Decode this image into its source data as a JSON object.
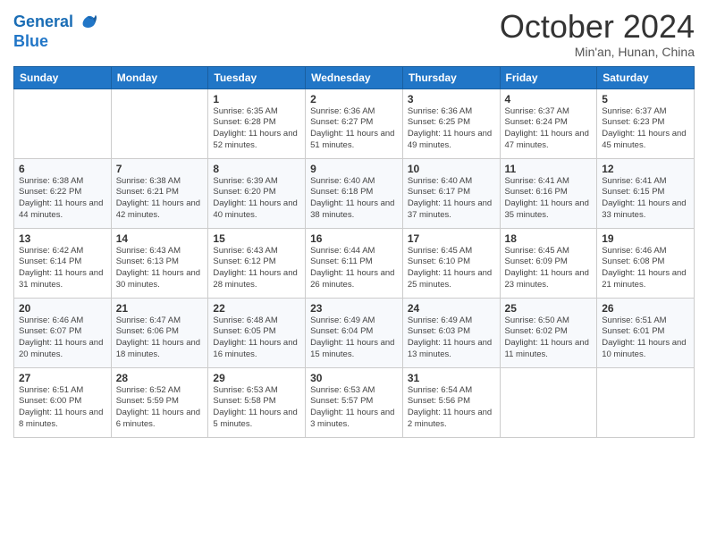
{
  "header": {
    "logo_line1": "General",
    "logo_line2": "Blue",
    "month": "October 2024",
    "location": "Min'an, Hunan, China"
  },
  "weekdays": [
    "Sunday",
    "Monday",
    "Tuesday",
    "Wednesday",
    "Thursday",
    "Friday",
    "Saturday"
  ],
  "weeks": [
    [
      {
        "day": "",
        "sunrise": "",
        "sunset": "",
        "daylight": ""
      },
      {
        "day": "",
        "sunrise": "",
        "sunset": "",
        "daylight": ""
      },
      {
        "day": "1",
        "sunrise": "Sunrise: 6:35 AM",
        "sunset": "Sunset: 6:28 PM",
        "daylight": "Daylight: 11 hours and 52 minutes."
      },
      {
        "day": "2",
        "sunrise": "Sunrise: 6:36 AM",
        "sunset": "Sunset: 6:27 PM",
        "daylight": "Daylight: 11 hours and 51 minutes."
      },
      {
        "day": "3",
        "sunrise": "Sunrise: 6:36 AM",
        "sunset": "Sunset: 6:25 PM",
        "daylight": "Daylight: 11 hours and 49 minutes."
      },
      {
        "day": "4",
        "sunrise": "Sunrise: 6:37 AM",
        "sunset": "Sunset: 6:24 PM",
        "daylight": "Daylight: 11 hours and 47 minutes."
      },
      {
        "day": "5",
        "sunrise": "Sunrise: 6:37 AM",
        "sunset": "Sunset: 6:23 PM",
        "daylight": "Daylight: 11 hours and 45 minutes."
      }
    ],
    [
      {
        "day": "6",
        "sunrise": "Sunrise: 6:38 AM",
        "sunset": "Sunset: 6:22 PM",
        "daylight": "Daylight: 11 hours and 44 minutes."
      },
      {
        "day": "7",
        "sunrise": "Sunrise: 6:38 AM",
        "sunset": "Sunset: 6:21 PM",
        "daylight": "Daylight: 11 hours and 42 minutes."
      },
      {
        "day": "8",
        "sunrise": "Sunrise: 6:39 AM",
        "sunset": "Sunset: 6:20 PM",
        "daylight": "Daylight: 11 hours and 40 minutes."
      },
      {
        "day": "9",
        "sunrise": "Sunrise: 6:40 AM",
        "sunset": "Sunset: 6:18 PM",
        "daylight": "Daylight: 11 hours and 38 minutes."
      },
      {
        "day": "10",
        "sunrise": "Sunrise: 6:40 AM",
        "sunset": "Sunset: 6:17 PM",
        "daylight": "Daylight: 11 hours and 37 minutes."
      },
      {
        "day": "11",
        "sunrise": "Sunrise: 6:41 AM",
        "sunset": "Sunset: 6:16 PM",
        "daylight": "Daylight: 11 hours and 35 minutes."
      },
      {
        "day": "12",
        "sunrise": "Sunrise: 6:41 AM",
        "sunset": "Sunset: 6:15 PM",
        "daylight": "Daylight: 11 hours and 33 minutes."
      }
    ],
    [
      {
        "day": "13",
        "sunrise": "Sunrise: 6:42 AM",
        "sunset": "Sunset: 6:14 PM",
        "daylight": "Daylight: 11 hours and 31 minutes."
      },
      {
        "day": "14",
        "sunrise": "Sunrise: 6:43 AM",
        "sunset": "Sunset: 6:13 PM",
        "daylight": "Daylight: 11 hours and 30 minutes."
      },
      {
        "day": "15",
        "sunrise": "Sunrise: 6:43 AM",
        "sunset": "Sunset: 6:12 PM",
        "daylight": "Daylight: 11 hours and 28 minutes."
      },
      {
        "day": "16",
        "sunrise": "Sunrise: 6:44 AM",
        "sunset": "Sunset: 6:11 PM",
        "daylight": "Daylight: 11 hours and 26 minutes."
      },
      {
        "day": "17",
        "sunrise": "Sunrise: 6:45 AM",
        "sunset": "Sunset: 6:10 PM",
        "daylight": "Daylight: 11 hours and 25 minutes."
      },
      {
        "day": "18",
        "sunrise": "Sunrise: 6:45 AM",
        "sunset": "Sunset: 6:09 PM",
        "daylight": "Daylight: 11 hours and 23 minutes."
      },
      {
        "day": "19",
        "sunrise": "Sunrise: 6:46 AM",
        "sunset": "Sunset: 6:08 PM",
        "daylight": "Daylight: 11 hours and 21 minutes."
      }
    ],
    [
      {
        "day": "20",
        "sunrise": "Sunrise: 6:46 AM",
        "sunset": "Sunset: 6:07 PM",
        "daylight": "Daylight: 11 hours and 20 minutes."
      },
      {
        "day": "21",
        "sunrise": "Sunrise: 6:47 AM",
        "sunset": "Sunset: 6:06 PM",
        "daylight": "Daylight: 11 hours and 18 minutes."
      },
      {
        "day": "22",
        "sunrise": "Sunrise: 6:48 AM",
        "sunset": "Sunset: 6:05 PM",
        "daylight": "Daylight: 11 hours and 16 minutes."
      },
      {
        "day": "23",
        "sunrise": "Sunrise: 6:49 AM",
        "sunset": "Sunset: 6:04 PM",
        "daylight": "Daylight: 11 hours and 15 minutes."
      },
      {
        "day": "24",
        "sunrise": "Sunrise: 6:49 AM",
        "sunset": "Sunset: 6:03 PM",
        "daylight": "Daylight: 11 hours and 13 minutes."
      },
      {
        "day": "25",
        "sunrise": "Sunrise: 6:50 AM",
        "sunset": "Sunset: 6:02 PM",
        "daylight": "Daylight: 11 hours and 11 minutes."
      },
      {
        "day": "26",
        "sunrise": "Sunrise: 6:51 AM",
        "sunset": "Sunset: 6:01 PM",
        "daylight": "Daylight: 11 hours and 10 minutes."
      }
    ],
    [
      {
        "day": "27",
        "sunrise": "Sunrise: 6:51 AM",
        "sunset": "Sunset: 6:00 PM",
        "daylight": "Daylight: 11 hours and 8 minutes."
      },
      {
        "day": "28",
        "sunrise": "Sunrise: 6:52 AM",
        "sunset": "Sunset: 5:59 PM",
        "daylight": "Daylight: 11 hours and 6 minutes."
      },
      {
        "day": "29",
        "sunrise": "Sunrise: 6:53 AM",
        "sunset": "Sunset: 5:58 PM",
        "daylight": "Daylight: 11 hours and 5 minutes."
      },
      {
        "day": "30",
        "sunrise": "Sunrise: 6:53 AM",
        "sunset": "Sunset: 5:57 PM",
        "daylight": "Daylight: 11 hours and 3 minutes."
      },
      {
        "day": "31",
        "sunrise": "Sunrise: 6:54 AM",
        "sunset": "Sunset: 5:56 PM",
        "daylight": "Daylight: 11 hours and 2 minutes."
      },
      {
        "day": "",
        "sunrise": "",
        "sunset": "",
        "daylight": ""
      },
      {
        "day": "",
        "sunrise": "",
        "sunset": "",
        "daylight": ""
      }
    ]
  ]
}
